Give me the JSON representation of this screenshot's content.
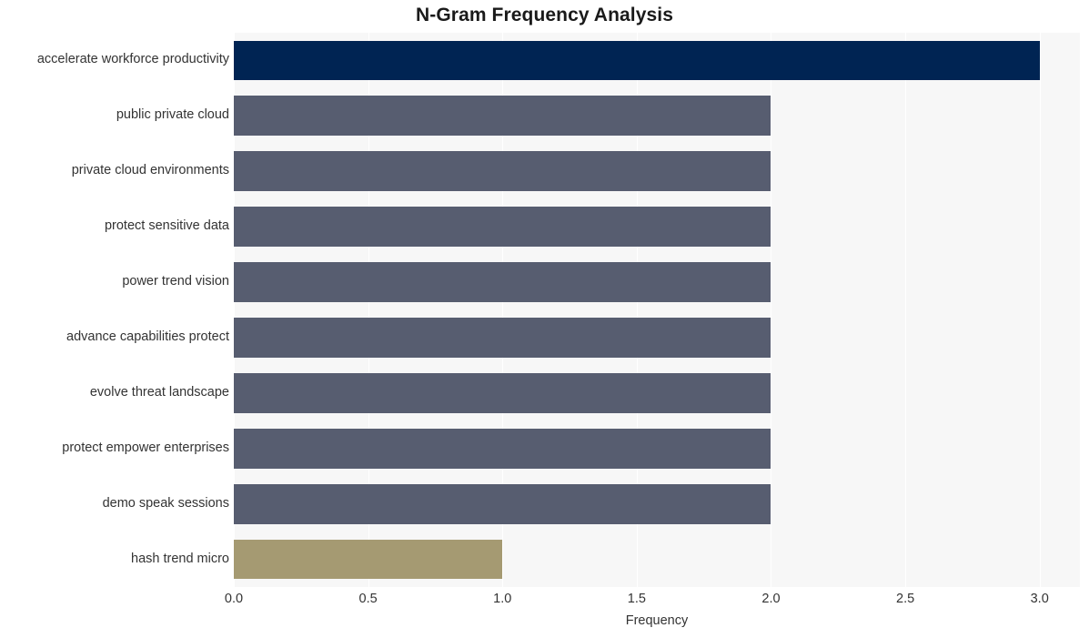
{
  "chart_data": {
    "type": "bar",
    "orientation": "horizontal",
    "title": "N-Gram Frequency Analysis",
    "xlabel": "Frequency",
    "ylabel": "",
    "xlim": [
      0,
      3.15
    ],
    "ylim": [
      0,
      10
    ],
    "grid": "vertical-white-gridlines",
    "legend": "none",
    "xticks": [
      "0.0",
      "0.5",
      "1.0",
      "1.5",
      "2.0",
      "2.5",
      "3.0"
    ],
    "xtick_values": [
      0.0,
      0.5,
      1.0,
      1.5,
      2.0,
      2.5,
      3.0
    ],
    "categories": [
      "accelerate workforce productivity",
      "public private cloud",
      "private cloud environments",
      "protect sensitive data",
      "power trend vision",
      "advance capabilities protect",
      "evolve threat landscape",
      "protect empower enterprises",
      "demo speak sessions",
      "hash trend micro"
    ],
    "values": [
      3,
      2,
      2,
      2,
      2,
      2,
      2,
      2,
      2,
      1
    ],
    "bar_colors": [
      "#002453",
      "#575d70",
      "#575d70",
      "#575d70",
      "#575d70",
      "#575d70",
      "#575d70",
      "#575d70",
      "#575d70",
      "#a59a72"
    ],
    "plot_background": "#f7f7f7",
    "figure_background": "#ffffff",
    "gridline_color": "#ffffff",
    "title_color": "#1a1a1a",
    "tick_color": "#333333"
  }
}
